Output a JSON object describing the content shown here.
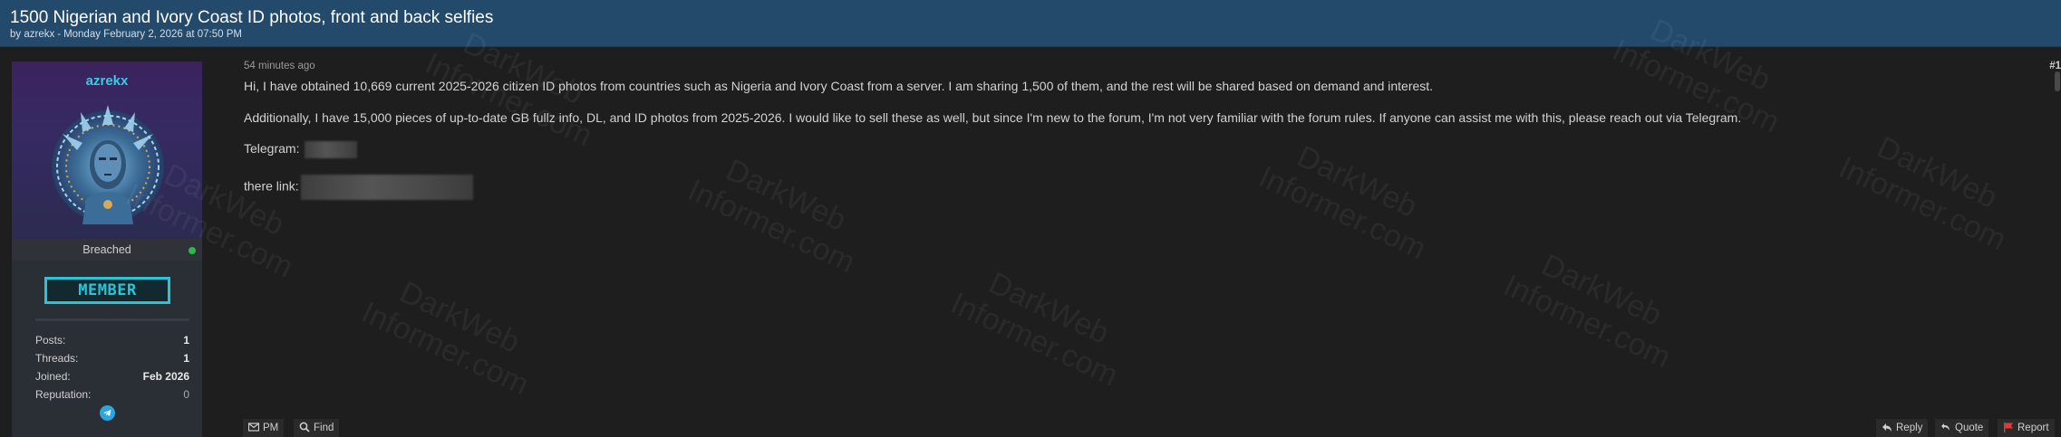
{
  "thread": {
    "title": "1500 Nigerian and Ivory Coast ID photos, front and back selfies",
    "meta_by": "by azrekx",
    "meta_sep": "-",
    "meta_date": "Monday February 2, 2026 at 07:50 PM"
  },
  "user": {
    "username": "azrekx",
    "status": "Breached",
    "role": "MEMBER",
    "stats": [
      {
        "label": "Posts:",
        "value": "1"
      },
      {
        "label": "Threads:",
        "value": "1"
      },
      {
        "label": "Joined:",
        "value": "Feb 2026"
      },
      {
        "label": "Reputation:",
        "value": "0"
      }
    ],
    "colors": {
      "username": "#2fd0e6",
      "badge": "#26c6d8",
      "online": "#2db84d"
    },
    "contact_icon": "telegram-icon"
  },
  "post": {
    "time": "54 minutes ago",
    "number": "#1",
    "paragraph_1": "Hi, I have obtained 10,669 current 2025-2026 citizen ID photos from countries such as Nigeria and Ivory Coast from a server. I am sharing 1,500 of them, and the rest will be shared based on demand and interest.",
    "paragraph_2": "Additionally, I have 15,000 pieces of up-to-date GB fullz info, DL, and ID photos from 2025-2026. I would like to sell these as well, but since I'm new to the forum, I'm not very familiar with the forum rules. If anyone can assist me with this, please reach out via Telegram.",
    "telegram_label": "Telegram:",
    "link_label": "there link:"
  },
  "footer": {
    "pm": "PM",
    "find": "Find",
    "reply": "Reply",
    "quote": "Quote",
    "report": "Report"
  },
  "watermark": {
    "line1": "DarkWeb",
    "line2": "Informer.com"
  }
}
